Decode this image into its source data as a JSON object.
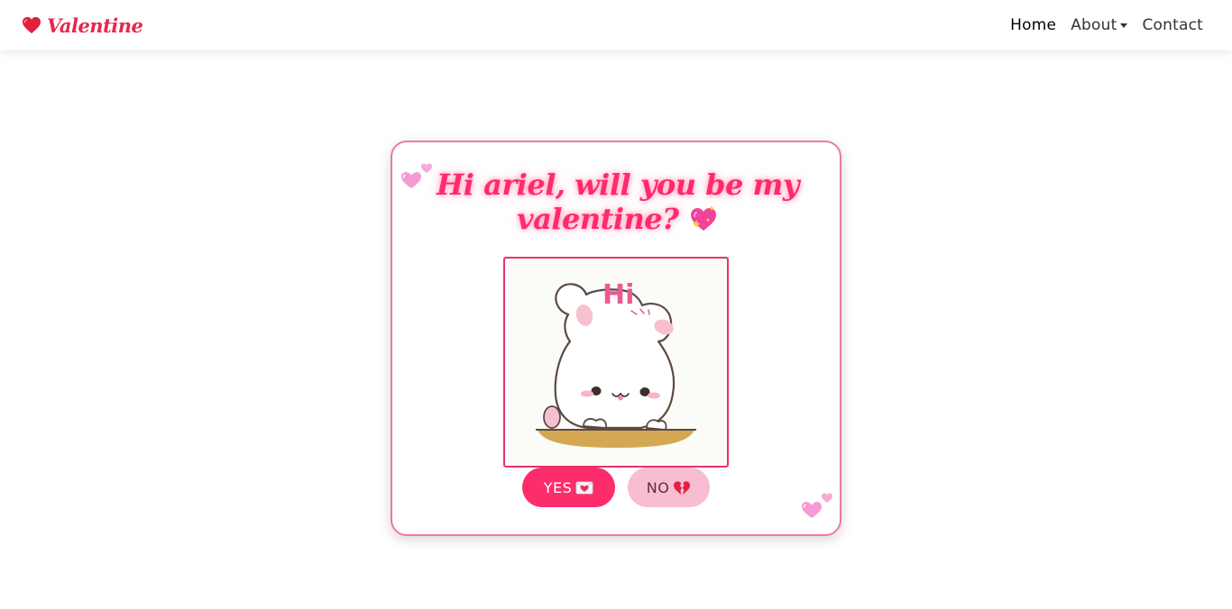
{
  "navbar": {
    "brand_text": "Valentine",
    "brand_icon": "red-heart-icon",
    "links": [
      {
        "label": "Home",
        "active": true
      },
      {
        "label": "About",
        "dropdown": true
      },
      {
        "label": "Contact"
      }
    ]
  },
  "card": {
    "title": "Hi ariel, will you be my valentine?",
    "title_icon": "sparkling-heart-icon",
    "image": {
      "caption_text": "Hi",
      "subject": "cute white bunny waving"
    },
    "yes_button": {
      "label": "YES",
      "icon": "love-letter-icon"
    },
    "no_button": {
      "label": "NO",
      "icon": "broken-heart-icon"
    },
    "decorations": [
      "two-hearts-icon",
      "two-hearts-icon"
    ]
  },
  "colors": {
    "accent": "#fd2c6b",
    "title": "#ff2a6e",
    "card_border": "#ef78a3",
    "no_button_bg": "#f8bdd2",
    "brand": "#e8264f"
  }
}
